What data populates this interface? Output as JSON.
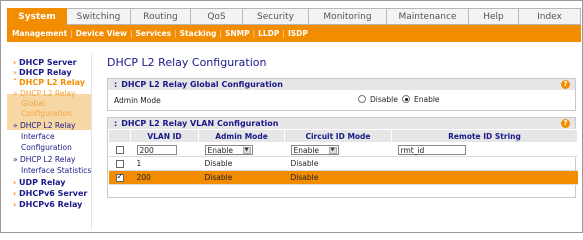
{
  "tabs": [
    {
      "label": "System",
      "active": true
    },
    {
      "label": "Switching",
      "active": false
    },
    {
      "label": "Routing",
      "active": false
    },
    {
      "label": "QoS",
      "active": false
    },
    {
      "label": "Security",
      "active": false
    },
    {
      "label": "Monitoring",
      "active": false
    },
    {
      "label": "Maintenance",
      "active": false
    },
    {
      "label": "Help",
      "active": false
    },
    {
      "label": "Index",
      "active": false
    }
  ],
  "subnav": {
    "items": [
      "Management",
      "Device View",
      "Services",
      "Stacking",
      "SNMP",
      "LLDP",
      "ISDP"
    ],
    "current": "Services"
  },
  "sidebar": {
    "items": [
      {
        "label": "DHCP Server",
        "level": 1
      },
      {
        "label": "DHCP Relay",
        "level": 1
      },
      {
        "label": "DHCP L2 Relay",
        "level": 1
      },
      {
        "label": "» DHCP L2 Relay",
        "level": 2
      },
      {
        "label": "Global",
        "level": 2
      },
      {
        "label": "Configuration",
        "level": 2
      },
      {
        "label": "» DHCP L2 Relay",
        "level": 2
      },
      {
        "label": "Interface",
        "level": 2
      },
      {
        "label": "Configuration",
        "level": 2
      },
      {
        "label": "» DHCP L2 Relay",
        "level": 2
      },
      {
        "label": "Interface Statistics",
        "level": 2
      },
      {
        "label": "UDP Relay",
        "level": 1
      },
      {
        "label": "DHCPv6 Server",
        "level": 1
      },
      {
        "label": "DHCPv6 Relay",
        "level": 1
      }
    ]
  },
  "page_title": "DHCP L2 Relay Configuration",
  "global_section": {
    "title": "DHCP L2 Relay Global Configuration",
    "admin_mode_label": "Admin Mode",
    "disable_label": "Disable",
    "enable_label": "Enable",
    "selected": "Enable"
  },
  "vlan_section": {
    "title": "DHCP L2 Relay VLAN Configuration",
    "columns": [
      "VLAN ID",
      "Admin Mode",
      "Circuit ID Mode",
      "Remote ID String"
    ],
    "edit_row": {
      "vlan_id": "200",
      "admin_mode": "Enable",
      "circuit_id_mode": "Enable",
      "remote_id": "rmt_id"
    },
    "rows": [
      {
        "vlan_id": "1",
        "admin_mode": "Disable",
        "circuit_id_mode": "Disable",
        "remote_id": "",
        "checked": false
      },
      {
        "vlan_id": "200",
        "admin_mode": "Disable",
        "circuit_id_mode": "Disable",
        "remote_id": "",
        "checked": true
      }
    ]
  },
  "colors": {
    "accent": "#f28c00",
    "nav_text": "#1a1a8a",
    "header_bg": "#e6e6e6"
  }
}
